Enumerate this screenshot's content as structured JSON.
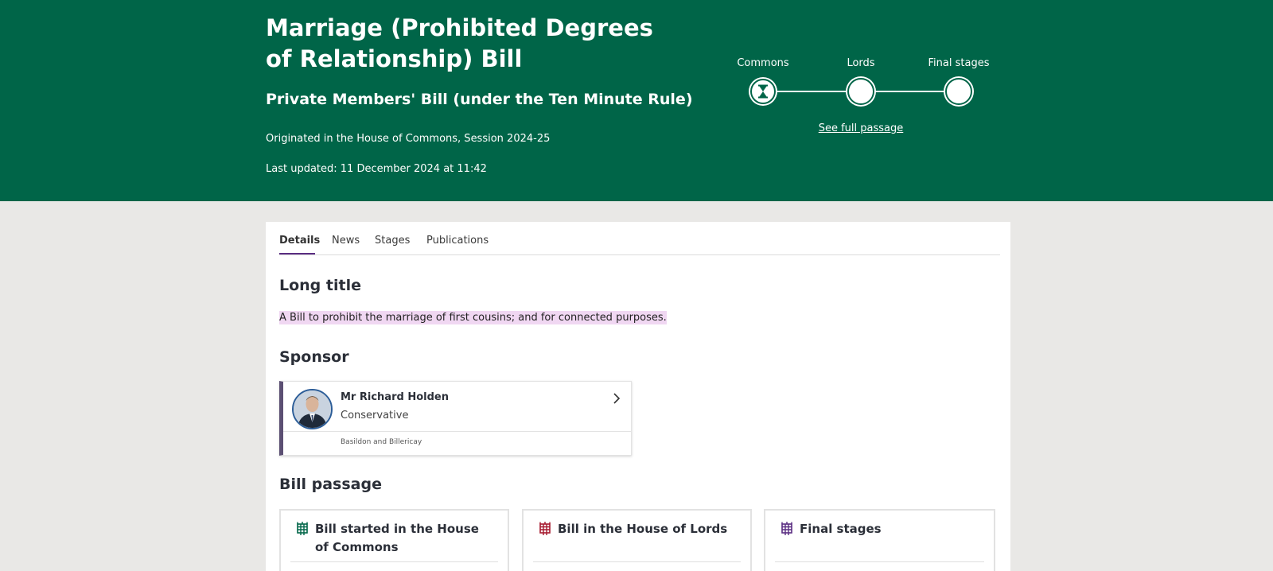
{
  "header": {
    "title": "Marriage (Prohibited Degrees of Relationship) Bill",
    "bill_type": "Private Members' Bill (under the Ten Minute Rule)",
    "origin": "Originated in the House of Commons, Session 2024-25",
    "last_updated": "Last updated: 11 December 2024 at 11:42",
    "stages": [
      {
        "label": "Commons",
        "state": "current"
      },
      {
        "label": "Lords",
        "state": "pending"
      },
      {
        "label": "Final stages",
        "state": "pending"
      }
    ],
    "see_full_passage": "See full passage",
    "colors": {
      "brand_green": "#006548",
      "commons": "#006548",
      "lords": "#a6192e",
      "final": "#5a2d82"
    }
  },
  "tabs": [
    {
      "label": "Details",
      "active": true
    },
    {
      "label": "News",
      "active": false
    },
    {
      "label": "Stages",
      "active": false
    },
    {
      "label": "Publications",
      "active": false
    }
  ],
  "details": {
    "long_title_heading": "Long title",
    "long_title_text": "A Bill to prohibit the marriage of first cousins; and for connected purposes.",
    "sponsor_heading": "Sponsor",
    "sponsor": {
      "name": "Mr Richard Holden",
      "party": "Conservative",
      "constituency": "Basildon and Billericay"
    },
    "passage_heading": "Bill passage",
    "passage_cards": [
      {
        "title": "Bill started in the House of Commons",
        "icon": "portcullis-icon"
      },
      {
        "title": "Bill in the House of Lords",
        "icon": "portcullis-icon"
      },
      {
        "title": "Final stages",
        "icon": "portcullis-icon"
      }
    ]
  }
}
